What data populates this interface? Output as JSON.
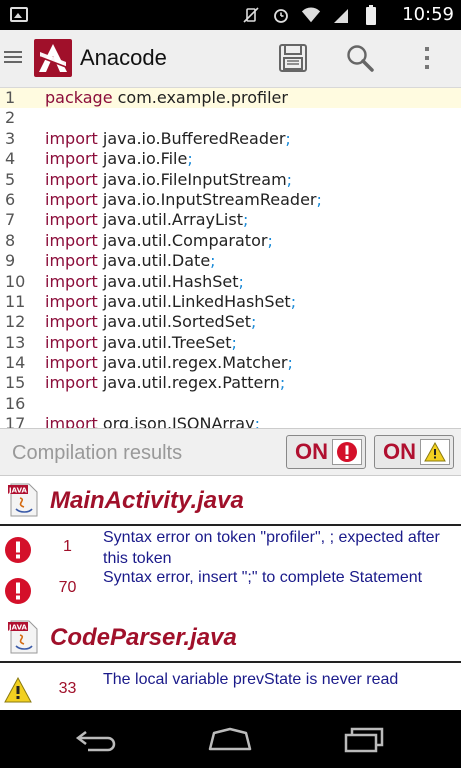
{
  "status_bar": {
    "time": "10:59",
    "icons": [
      "image-notification-icon",
      "vibrate-off-icon",
      "alarm-icon",
      "wifi-icon",
      "cell-signal-icon",
      "battery-icon"
    ]
  },
  "app_bar": {
    "title": "Anacode",
    "logo_letter": "A",
    "actions": [
      "save-icon",
      "search-icon",
      "overflow-menu-icon"
    ]
  },
  "editor": {
    "active_line": 1,
    "lines": [
      {
        "n": "1",
        "kw": "package",
        "id": " com.example.profiler",
        "semi": ""
      },
      {
        "n": "2",
        "kw": "",
        "id": "",
        "semi": ""
      },
      {
        "n": "3",
        "kw": "import",
        "id": " java.io.BufferedReader",
        "semi": ";"
      },
      {
        "n": "4",
        "kw": "import",
        "id": " java.io.File",
        "semi": ";"
      },
      {
        "n": "5",
        "kw": "import",
        "id": " java.io.FileInputStream",
        "semi": ";"
      },
      {
        "n": "6",
        "kw": "import",
        "id": " java.io.InputStreamReader",
        "semi": ";"
      },
      {
        "n": "7",
        "kw": "import",
        "id": " java.util.ArrayList",
        "semi": ";"
      },
      {
        "n": "8",
        "kw": "import",
        "id": " java.util.Comparator",
        "semi": ";"
      },
      {
        "n": "9",
        "kw": "import",
        "id": " java.util.Date",
        "semi": ";"
      },
      {
        "n": "10",
        "kw": "import",
        "id": " java.util.HashSet",
        "semi": ";"
      },
      {
        "n": "11",
        "kw": "import",
        "id": " java.util.LinkedHashSet",
        "semi": ";"
      },
      {
        "n": "12",
        "kw": "import",
        "id": " java.util.SortedSet",
        "semi": ";"
      },
      {
        "n": "13",
        "kw": "import",
        "id": " java.util.TreeSet",
        "semi": ";"
      },
      {
        "n": "14",
        "kw": "import",
        "id": " java.util.regex.Matcher",
        "semi": ";"
      },
      {
        "n": "15",
        "kw": "import",
        "id": " java.util.regex.Pattern",
        "semi": ";"
      },
      {
        "n": "16",
        "kw": "",
        "id": "",
        "semi": ""
      },
      {
        "n": "17",
        "kw": "import",
        "id": " org.json.JSONArray",
        "semi": ";"
      }
    ]
  },
  "compilation": {
    "title": "Compilation results",
    "errors_toggle": "ON",
    "warnings_toggle": "ON",
    "files": [
      {
        "name": "MainActivity.java",
        "file_icon_label": "JAVA",
        "items": [
          {
            "severity": "error",
            "line": "1",
            "message": "Syntax error on token \"profiler\", ; expected after this token"
          },
          {
            "severity": "error",
            "line": "70",
            "message": "Syntax error, insert \";\" to complete Statement"
          }
        ]
      },
      {
        "name": "CodeParser.java",
        "file_icon_label": "JAVA",
        "items": [
          {
            "severity": "warning",
            "line": "33",
            "message": "The local variable prevState is never read"
          }
        ]
      }
    ]
  },
  "colors": {
    "brand": "#a0102a",
    "keyword": "#8b0d3a",
    "semicolon": "#1a8ad8",
    "message": "#1a1a8a",
    "error_red": "#d4102a",
    "warning_yellow": "#f2d020"
  },
  "nav_bar": {
    "buttons": [
      "back-icon",
      "home-icon",
      "recents-icon"
    ]
  }
}
